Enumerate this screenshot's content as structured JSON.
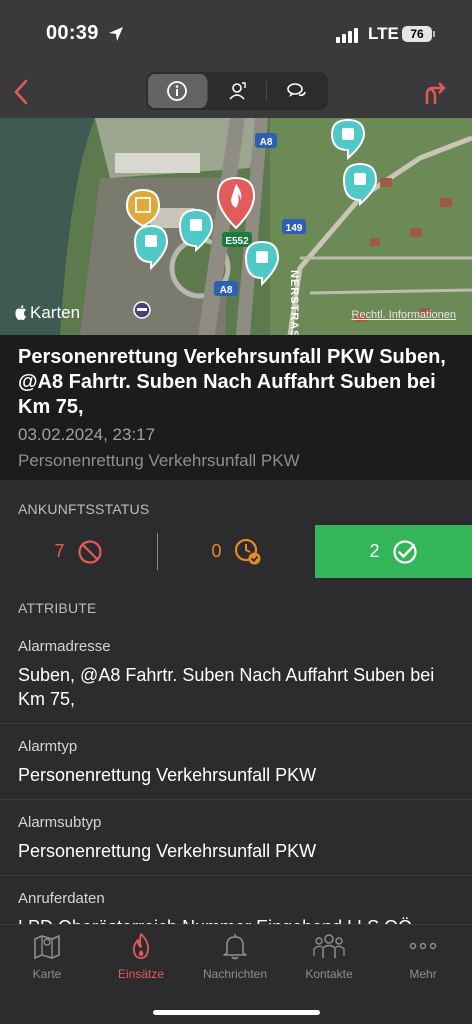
{
  "status": {
    "time": "00:39",
    "network": "LTE",
    "battery": "76"
  },
  "nav": {
    "back_icon": "chevron-left-icon",
    "segments": [
      {
        "icon": "info-icon",
        "active": true
      },
      {
        "icon": "person-pin-icon",
        "active": false
      },
      {
        "icon": "chat-bubbles-icon",
        "active": false
      }
    ],
    "route_icon": "route-directions-icon"
  },
  "map": {
    "credit": "Karten",
    "legal": "Rechtl. Informationen",
    "road_labels": [
      "A8",
      "E552",
      "149",
      "A8"
    ],
    "street_label": "NERSTRASSE"
  },
  "incident": {
    "title": "Personenrettung Verkehrsunfall PKW Suben, @A8 Fahrtr. Suben Nach Auffahrt Suben bei Km 75,",
    "datetime": "03.02.2024, 23:17",
    "subtitle": "Personenrettung Verkehrsunfall PKW"
  },
  "arrival": {
    "header": "ANKUNFTSSTATUS",
    "declined": "7",
    "pending": "0",
    "confirmed": "2"
  },
  "attributes": {
    "header": "ATTRIBUTE",
    "items": [
      {
        "label": "Alarmadresse",
        "value": "Suben, @A8 Fahrtr. Suben Nach Auffahrt Suben bei Km 75,"
      },
      {
        "label": "Alarmtyp",
        "value": "Personenrettung Verkehrsunfall PKW"
      },
      {
        "label": "Alarmsubtyp",
        "value": "Personenrettung Verkehrsunfall PKW"
      },
      {
        "label": "Anruferdaten",
        "value": "LPD Oberösterreich Nummer Eingehend LLS OÖ"
      }
    ]
  },
  "tabs": [
    {
      "label": "Karte",
      "icon": "map-icon"
    },
    {
      "label": "Einsätze",
      "icon": "flame-icon",
      "active": true
    },
    {
      "label": "Nachrichten",
      "icon": "bell-icon"
    },
    {
      "label": "Kontakte",
      "icon": "contacts-icon"
    },
    {
      "label": "Mehr",
      "icon": "more-dots-icon"
    }
  ],
  "colors": {
    "accent_red": "#e45b5b",
    "confirm_green": "#34b55a",
    "pending_orange": "#e38a2c",
    "hydrant_teal": "#4fc9c6"
  }
}
